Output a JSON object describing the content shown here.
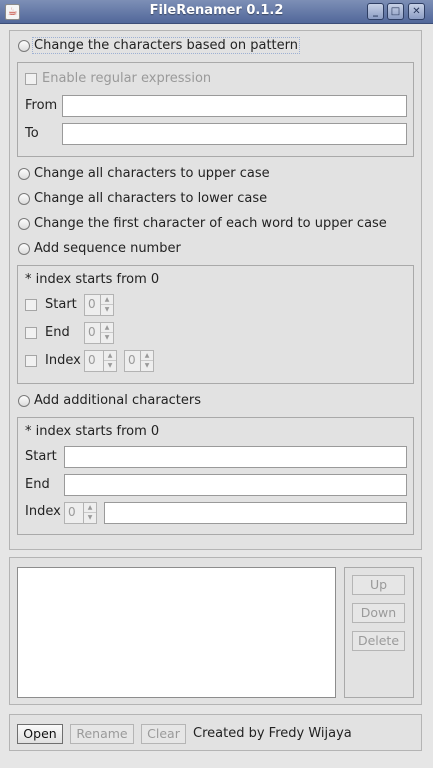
{
  "window": {
    "title": "FileRenamer 0.1.2"
  },
  "options": {
    "pattern_label": "Change the characters based on pattern",
    "upper_label": "Change all characters to upper case",
    "lower_label": "Change all characters to lower case",
    "capitalize_label": "Change the first character of each word to upper case",
    "sequence_label": "Add sequence number",
    "additional_label": "Add additional characters"
  },
  "pattern": {
    "regex_label": "Enable regular expression",
    "from_label": "From",
    "from_value": "",
    "to_label": "To",
    "to_value": ""
  },
  "sequence": {
    "note": "* index starts from 0",
    "start_label": "Start",
    "start_value": "0",
    "end_label": "End",
    "end_value": "0",
    "index_label": "Index",
    "index_value_1": "0",
    "index_value_2": "0"
  },
  "additional": {
    "note": "* index starts from 0",
    "start_label": "Start",
    "start_value": "",
    "end_label": "End",
    "end_value": "",
    "index_label": "Index",
    "index_value": "0",
    "index_text": ""
  },
  "list_buttons": {
    "up": "Up",
    "down": "Down",
    "delete": "Delete"
  },
  "bottom": {
    "open": "Open",
    "rename": "Rename",
    "clear": "Clear",
    "credit": "Created by Fredy Wijaya"
  },
  "icons": {
    "app": "java-cup-icon",
    "minimize": "minimize-icon",
    "maximize": "maximize-icon",
    "close": "close-icon"
  }
}
